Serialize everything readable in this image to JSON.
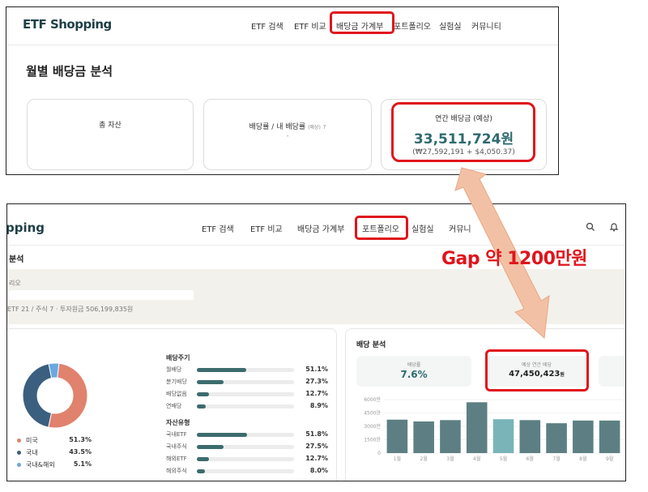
{
  "top": {
    "brand": "ETF Shopping",
    "nav": [
      "ETF 검색",
      "ETF 비교",
      "배당금 가계부",
      "포트폴리오",
      "실험실",
      "커뮤니티"
    ],
    "page_title": "월별 배당금 분석",
    "card_total_label": "총 자산",
    "card_yield_label": "배당률 / 내 배당률",
    "card_yield_small": "(예상)",
    "card_yield_help": "?",
    "card_yield_value": "-",
    "card_annual_label": "연간 배당금 (예상)",
    "card_annual_value": "33,511,724원",
    "card_annual_sub": "(₩27,592,191 + $4,050.37)"
  },
  "bottom": {
    "brand": "pping",
    "nav": [
      "ETF 검색",
      "ETF 비교",
      "배당금 가계부",
      "포트폴리오",
      "실험실",
      "커뮤니"
    ],
    "page_title": "분석",
    "section_label": "리오",
    "portfolio_meta": "ETF 21 / 주식 7 · 투자원금 506,199,835원",
    "legend": [
      {
        "label": "미국",
        "value": "51.3%",
        "color": "#e0826d"
      },
      {
        "label": "국내",
        "value": "43.5%",
        "color": "#3b5f7f"
      },
      {
        "label": "국내&해외",
        "value": "5.1%",
        "color": "#6aa8e0"
      }
    ],
    "cycle_head": "배당주기",
    "cycle": [
      {
        "label": "월배당",
        "value": "51.1%",
        "frac": 0.511
      },
      {
        "label": "분기배당",
        "value": "27.3%",
        "frac": 0.273
      },
      {
        "label": "배당없음",
        "value": "12.7%",
        "frac": 0.127
      },
      {
        "label": "연배당",
        "value": "8.9%",
        "frac": 0.089
      }
    ],
    "asset_head": "자산유형",
    "asset": [
      {
        "label": "국내ETF",
        "value": "51.8%",
        "frac": 0.518
      },
      {
        "label": "국내주식",
        "value": "27.5%",
        "frac": 0.275
      },
      {
        "label": "해외ETF",
        "value": "12.7%",
        "frac": 0.127
      },
      {
        "label": "해외주식",
        "value": "8.0%",
        "frac": 0.08
      }
    ],
    "analysis_title": "배당 분석",
    "stat_yield_label": "배당률",
    "stat_yield_value": "7.6%",
    "stat_annual_label": "예상 연간 배당",
    "stat_annual_value": "47,450,423",
    "stat_annual_unit": "원"
  },
  "annotation": {
    "gap_text": "Gap 약 1200만원"
  },
  "chart_data": {
    "type": "bar",
    "categories": [
      "1월",
      "2월",
      "3월",
      "4월",
      "5월",
      "6월",
      "7월",
      "8월",
      "9월"
    ],
    "values": [
      3750,
      3550,
      3700,
      5700,
      3800,
      3700,
      3350,
      3650,
      3650
    ],
    "highlight_index": 4,
    "yticks": [
      "6000만",
      "4500만",
      "3000만",
      "1500만",
      "0"
    ],
    "ylim": [
      0,
      6000
    ],
    "colors": {
      "bar": "#5d7f83",
      "highlight": "#7ab4b8"
    }
  },
  "colors": {
    "accent": "#2f6b6f",
    "annotation_red": "#e0141c",
    "arrow": "#f2c1a5"
  }
}
